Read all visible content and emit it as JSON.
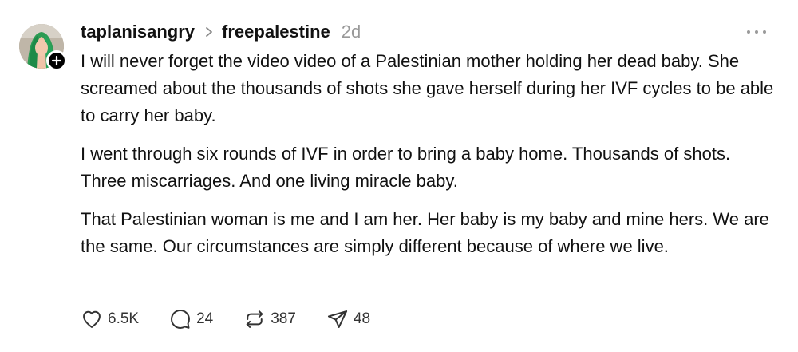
{
  "post": {
    "username": "taplanisangry",
    "community": "freepalestine",
    "time": "2d",
    "paragraphs": [
      "I will never forget the video video of a Palestinian mother holding her dead baby. She screamed about the thousands of shots she gave herself during her IVF cycles to be able to carry her baby.",
      "I went through six rounds of IVF in order to bring a baby home. Thousands of shots. Three miscarriages. And one living miracle baby.",
      "That Palestinian woman is me and I am her. Her baby is my baby and mine hers. We are the same. Our circumstances are simply different because of where we live."
    ],
    "actions": {
      "likes": "6.5K",
      "comments": "24",
      "reposts": "387",
      "shares": "48"
    }
  },
  "icons": {
    "avatar": "user-avatar",
    "follow": "plus-icon",
    "chevron": "chevron-right-icon",
    "more": "more-horizontal-icon",
    "like": "heart-icon",
    "comment": "comment-icon",
    "repost": "repost-icon",
    "share": "send-icon"
  },
  "colors": {
    "text": "#111111",
    "muted": "#999999",
    "icon": "#333333",
    "badge": "#000000"
  }
}
